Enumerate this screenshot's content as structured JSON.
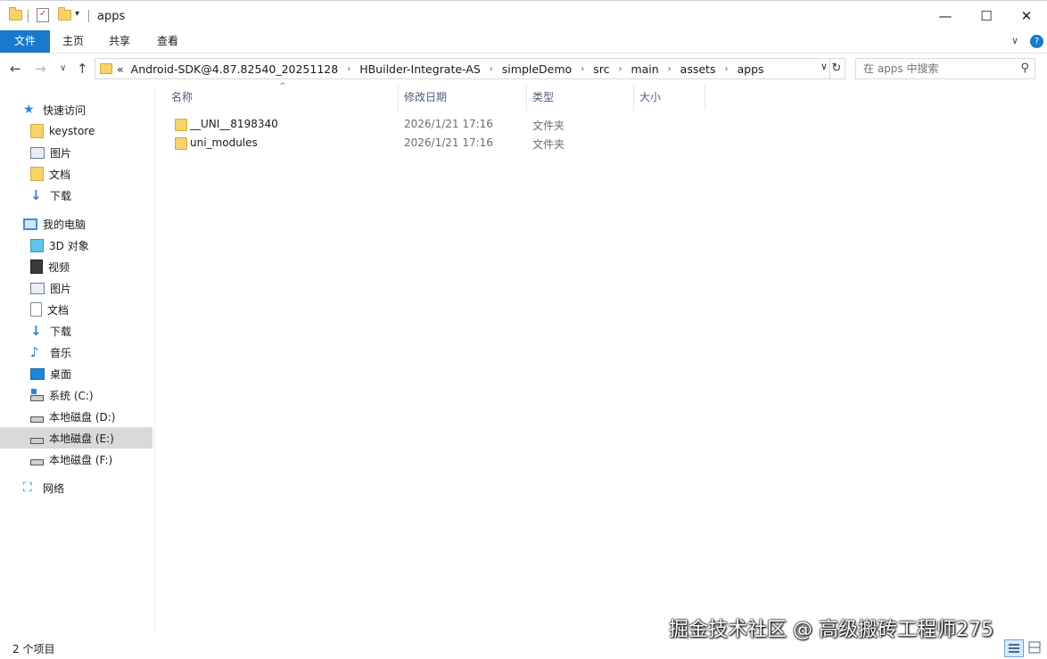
{
  "window": {
    "title": "apps",
    "minimize_glyph": "—",
    "maximize_glyph": "☐",
    "close_glyph": "✕"
  },
  "ribbon": {
    "tabs": [
      "文件",
      "主页",
      "共享",
      "查看"
    ],
    "help_glyph": "?",
    "collapse_glyph": "∨"
  },
  "nav": {
    "back_glyph": "←",
    "forward_glyph": "→",
    "recent_glyph": "∨",
    "up_glyph": "↑"
  },
  "address": {
    "overflow": "«",
    "crumbs": [
      "Android-SDK@4.87.82540_20251128",
      "HBuilder-Integrate-AS",
      "simpleDemo",
      "src",
      "main",
      "assets",
      "apps"
    ],
    "separator": "›",
    "dropdown_glyph": "∨",
    "refresh_glyph": "↻"
  },
  "search": {
    "placeholder": "在 apps 中搜索",
    "icon_glyph": "⚲"
  },
  "sidebar": {
    "items": [
      {
        "label": "快速访问",
        "icon": "star-icon",
        "level": 0
      },
      {
        "label": "keystore",
        "icon": "folder-icon",
        "level": 1
      },
      {
        "label": "图片",
        "icon": "pictures-icon",
        "level": 1
      },
      {
        "label": "文档",
        "icon": "folder-icon",
        "level": 1
      },
      {
        "label": "下载",
        "icon": "download-icon",
        "level": 1
      },
      {
        "label": "我的电脑",
        "icon": "computer-icon",
        "level": 0
      },
      {
        "label": "3D 对象",
        "icon": "3d-objects-icon",
        "level": 1
      },
      {
        "label": "视频",
        "icon": "video-icon",
        "level": 1
      },
      {
        "label": "图片",
        "icon": "pictures-icon",
        "level": 1
      },
      {
        "label": "文档",
        "icon": "document-icon",
        "level": 1
      },
      {
        "label": "下载",
        "icon": "download-icon",
        "level": 1
      },
      {
        "label": "音乐",
        "icon": "music-icon",
        "level": 1
      },
      {
        "label": "桌面",
        "icon": "desktop-icon",
        "level": 1
      },
      {
        "label": "系统 (C:)",
        "icon": "system-drive-icon",
        "level": 1
      },
      {
        "label": "本地磁盘 (D:)",
        "icon": "drive-icon",
        "level": 1
      },
      {
        "label": "本地磁盘 (E:)",
        "icon": "drive-icon",
        "level": 1,
        "selected": true
      },
      {
        "label": "本地磁盘 (F:)",
        "icon": "drive-icon",
        "level": 1
      },
      {
        "label": "网络",
        "icon": "network-icon",
        "level": 0
      }
    ]
  },
  "columns": {
    "name": "名称",
    "modified": "修改日期",
    "type": "类型",
    "size": "大小",
    "sort_glyph": "^"
  },
  "files": [
    {
      "name": "__UNI__8198340",
      "modified": "2026/1/21 17:16",
      "type": "文件夹"
    },
    {
      "name": "uni_modules",
      "modified": "2026/1/21 17:16",
      "type": "文件夹"
    }
  ],
  "status": {
    "item_count": "2 个项目"
  },
  "watermark": "掘金技术社区 @ 高级搬砖工程师275",
  "colors": {
    "accent": "#1979ca",
    "folder": "#f6d36b",
    "selection": "#d9d9d9"
  }
}
